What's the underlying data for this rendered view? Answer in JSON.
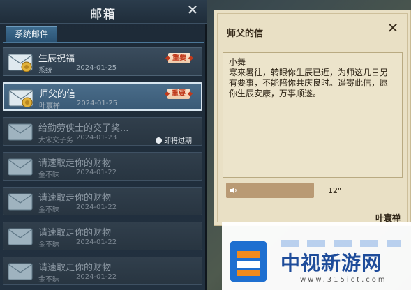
{
  "mailbox": {
    "title": "邮箱",
    "tab": "系统邮件",
    "mails": [
      {
        "subject": "生辰祝福",
        "sender": "系统",
        "date": "2024-01-25",
        "badge": "重要",
        "expire": "",
        "state": "unread"
      },
      {
        "subject": "师父的信",
        "sender": "叶寰禅",
        "date": "2024-01-25",
        "badge": "重要",
        "expire": "",
        "state": "selected"
      },
      {
        "subject": "给勤劳侠士的交子奖...",
        "sender": "大宋交子务",
        "date": "2024-01-23",
        "badge": "",
        "expire": "即将过期",
        "state": "read"
      },
      {
        "subject": "请速取走你的财物",
        "sender": "金不昧",
        "date": "2024-01-22",
        "badge": "",
        "expire": "",
        "state": "read"
      },
      {
        "subject": "请速取走你的财物",
        "sender": "金不昧",
        "date": "2024-01-22",
        "badge": "",
        "expire": "",
        "state": "read"
      },
      {
        "subject": "请速取走你的财物",
        "sender": "金不昧",
        "date": "2024-01-22",
        "badge": "",
        "expire": "",
        "state": "read"
      },
      {
        "subject": "请速取走你的财物",
        "sender": "金不昧",
        "date": "2024-01-22",
        "badge": "",
        "expire": "",
        "state": "read"
      }
    ]
  },
  "letter": {
    "title": "师父的信",
    "salutation": "小舞",
    "body": "寒来暑往，转眼你生辰已近，为师这几日另有要事，不能陪你共庆良时。遥寄此信，愿你生辰安康，万事顺遂。",
    "voice_duration": "12\"",
    "signature": "叶寰禅",
    "speaker_icon": "speaker-icon"
  },
  "watermark": {
    "brand": "中视新游网",
    "url": "www.315ict.com"
  },
  "colors": {
    "badge_text": "#c0391b",
    "letter_paper": "#e9e0c5",
    "watermark_blue": "#1e4c9a"
  }
}
